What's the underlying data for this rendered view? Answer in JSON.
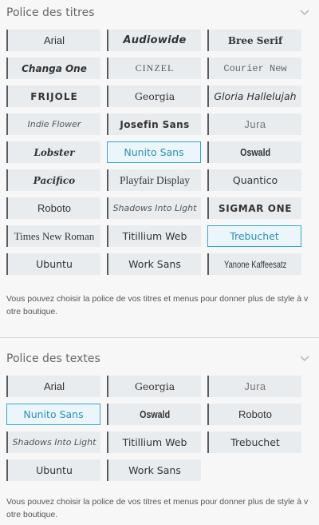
{
  "titles_section": {
    "heading": "Police des titres",
    "selected": [
      "Nunito Sans",
      "Trebuchet"
    ],
    "fonts": [
      {
        "label": "Arial",
        "style": "arial"
      },
      {
        "label": "Audiowide",
        "style": "audiowide"
      },
      {
        "label": "Bree Serif",
        "style": "bree"
      },
      {
        "label": "Changa One",
        "style": "changa"
      },
      {
        "label": "Cinzel",
        "style": "cinzel"
      },
      {
        "label": "Courier New",
        "style": "courier"
      },
      {
        "label": "Frijole",
        "style": "frijole"
      },
      {
        "label": "Georgia",
        "style": "georgia"
      },
      {
        "label": "Gloria Hallelujah",
        "style": "gloria"
      },
      {
        "label": "Indie Flower",
        "style": "indie"
      },
      {
        "label": "Josefin Sans",
        "style": "josefin"
      },
      {
        "label": "Jura",
        "style": "jura"
      },
      {
        "label": "Lobster",
        "style": "lobster"
      },
      {
        "label": "Nunito Sans",
        "style": "nunito"
      },
      {
        "label": "Oswald",
        "style": "oswald"
      },
      {
        "label": "Pacifico",
        "style": "pacifico"
      },
      {
        "label": "Playfair Display",
        "style": "playfair"
      },
      {
        "label": "Quantico",
        "style": "quantico"
      },
      {
        "label": "Roboto",
        "style": "roboto"
      },
      {
        "label": "Shadows Into Light",
        "style": "shadows"
      },
      {
        "label": "Sigmar One",
        "style": "sigmar"
      },
      {
        "label": "Times New Roman",
        "style": "tnr"
      },
      {
        "label": "Titillium Web",
        "style": "titillium"
      },
      {
        "label": "Trebuchet",
        "style": "trebuchet"
      },
      {
        "label": "Ubuntu",
        "style": "ubuntu"
      },
      {
        "label": "Work Sans",
        "style": "worksans"
      },
      {
        "label": "Yanone Kaffeesatz",
        "style": "yanone"
      }
    ],
    "description": "Vous pouvez choisir la police de vos titres et menus pour donner plus de style à votre boutique."
  },
  "texts_section": {
    "heading": "Police des textes",
    "selected": [
      "Nunito Sans"
    ],
    "fonts": [
      {
        "label": "Arial",
        "style": "arial"
      },
      {
        "label": "Georgia",
        "style": "georgia"
      },
      {
        "label": "Jura",
        "style": "jura"
      },
      {
        "label": "Nunito Sans",
        "style": "nunito"
      },
      {
        "label": "Oswald",
        "style": "oswald"
      },
      {
        "label": "Roboto",
        "style": "roboto"
      },
      {
        "label": "Shadows Into Light",
        "style": "shadows"
      },
      {
        "label": "Titillium Web",
        "style": "titillium"
      },
      {
        "label": "Trebuchet",
        "style": "trebuchet"
      },
      {
        "label": "Ubuntu",
        "style": "ubuntu"
      },
      {
        "label": "Work Sans",
        "style": "worksans"
      }
    ],
    "description": "Vous pouvez choisir la police de vos titres et menus pour donner plus de style à votre boutique."
  },
  "icons": {
    "collapse": "chevron-down-icon"
  },
  "colors": {
    "tile_bg": "#e9ecef",
    "tile_accent": "#555c63",
    "selected_border": "#35a6c9",
    "selected_text": "#2f8fb4"
  }
}
